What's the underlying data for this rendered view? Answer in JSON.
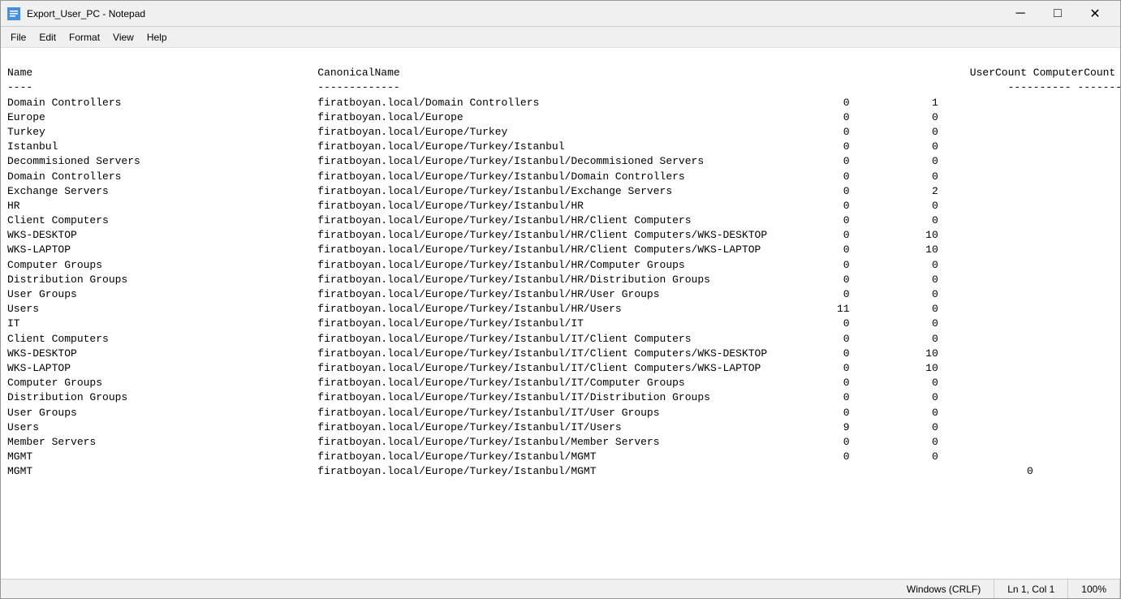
{
  "window": {
    "title": "Export_User_PC - Notepad",
    "icon": "notepad-icon"
  },
  "controls": {
    "minimize": "─",
    "maximize": "□",
    "close": "✕"
  },
  "menu": {
    "items": [
      "File",
      "Edit",
      "Format",
      "View",
      "Help"
    ]
  },
  "content": {
    "header_line": "Name                                             CanonicalName                                                                                          UserCount ComputerCount",
    "separator": "----                                             -------------                                                                                          --------- -------------",
    "rows": [
      {
        "name": "Domain Controllers",
        "canonical": "firatboyan.local/Domain Controllers",
        "userCount": "0",
        "computerCount": "1"
      },
      {
        "name": "Europe",
        "canonical": "firatboyan.local/Europe",
        "userCount": "0",
        "computerCount": "0"
      },
      {
        "name": "Turkey",
        "canonical": "firatboyan.local/Europe/Turkey",
        "userCount": "0",
        "computerCount": "0"
      },
      {
        "name": "Istanbul",
        "canonical": "firatboyan.local/Europe/Turkey/Istanbul",
        "userCount": "0",
        "computerCount": "0"
      },
      {
        "name": "Decommisioned Servers",
        "canonical": "firatboyan.local/Europe/Turkey/Istanbul/Decommisioned Servers",
        "userCount": "0",
        "computerCount": "0"
      },
      {
        "name": "Domain Controllers",
        "canonical": "firatboyan.local/Europe/Turkey/Istanbul/Domain Controllers",
        "userCount": "0",
        "computerCount": "0"
      },
      {
        "name": "Exchange Servers",
        "canonical": "firatboyan.local/Europe/Turkey/Istanbul/Exchange Servers",
        "userCount": "0",
        "computerCount": "2"
      },
      {
        "name": "HR",
        "canonical": "firatboyan.local/Europe/Turkey/Istanbul/HR",
        "userCount": "0",
        "computerCount": "0"
      },
      {
        "name": "Client Computers",
        "canonical": "firatboyan.local/Europe/Turkey/Istanbul/HR/Client Computers",
        "userCount": "0",
        "computerCount": "0"
      },
      {
        "name": "WKS-DESKTOP",
        "canonical": "firatboyan.local/Europe/Turkey/Istanbul/HR/Client Computers/WKS-DESKTOP",
        "userCount": "0",
        "computerCount": "10"
      },
      {
        "name": "WKS-LAPTOP",
        "canonical": "firatboyan.local/Europe/Turkey/Istanbul/HR/Client Computers/WKS-LAPTOP",
        "userCount": "0",
        "computerCount": "10"
      },
      {
        "name": "Computer Groups",
        "canonical": "firatboyan.local/Europe/Turkey/Istanbul/HR/Computer Groups",
        "userCount": "0",
        "computerCount": "0"
      },
      {
        "name": "Distribution Groups",
        "canonical": "firatboyan.local/Europe/Turkey/Istanbul/HR/Distribution Groups",
        "userCount": "0",
        "computerCount": "0"
      },
      {
        "name": "User Groups",
        "canonical": "firatboyan.local/Europe/Turkey/Istanbul/HR/User Groups",
        "userCount": "0",
        "computerCount": "0"
      },
      {
        "name": "Users",
        "canonical": "firatboyan.local/Europe/Turkey/Istanbul/HR/Users",
        "userCount": "11",
        "computerCount": "0"
      },
      {
        "name": "IT",
        "canonical": "firatboyan.local/Europe/Turkey/Istanbul/IT",
        "userCount": "0",
        "computerCount": "0"
      },
      {
        "name": "Client Computers",
        "canonical": "firatboyan.local/Europe/Turkey/Istanbul/IT/Client Computers",
        "userCount": "0",
        "computerCount": "0"
      },
      {
        "name": "WKS-DESKTOP",
        "canonical": "firatboyan.local/Europe/Turkey/Istanbul/IT/Client Computers/WKS-DESKTOP",
        "userCount": "0",
        "computerCount": "10"
      },
      {
        "name": "WKS-LAPTOP",
        "canonical": "firatboyan.local/Europe/Turkey/Istanbul/IT/Client Computers/WKS-LAPTOP",
        "userCount": "0",
        "computerCount": "10"
      },
      {
        "name": "Computer Groups",
        "canonical": "firatboyan.local/Europe/Turkey/Istanbul/IT/Computer Groups",
        "userCount": "0",
        "computerCount": "0"
      },
      {
        "name": "Distribution Groups",
        "canonical": "firatboyan.local/Europe/Turkey/Istanbul/IT/Distribution Groups",
        "userCount": "0",
        "computerCount": "0"
      },
      {
        "name": "User Groups",
        "canonical": "firatboyan.local/Europe/Turkey/Istanbul/IT/User Groups",
        "userCount": "0",
        "computerCount": "0"
      },
      {
        "name": "Users",
        "canonical": "firatboyan.local/Europe/Turkey/Istanbul/IT/Users",
        "userCount": "9",
        "computerCount": "0"
      },
      {
        "name": "Member Servers",
        "canonical": "firatboyan.local/Europe/Turkey/Istanbul/Member Servers",
        "userCount": "0",
        "computerCount": "0"
      },
      {
        "name": "MGMT",
        "canonical": "firatboyan.local/Europe/Turkey/Istanbul/MGMT",
        "userCount": "0",
        "computerCount": "0"
      }
    ]
  },
  "statusbar": {
    "line_ending": "Windows (CRLF)",
    "position": "Ln 1, Col 1",
    "zoom": "100%"
  }
}
